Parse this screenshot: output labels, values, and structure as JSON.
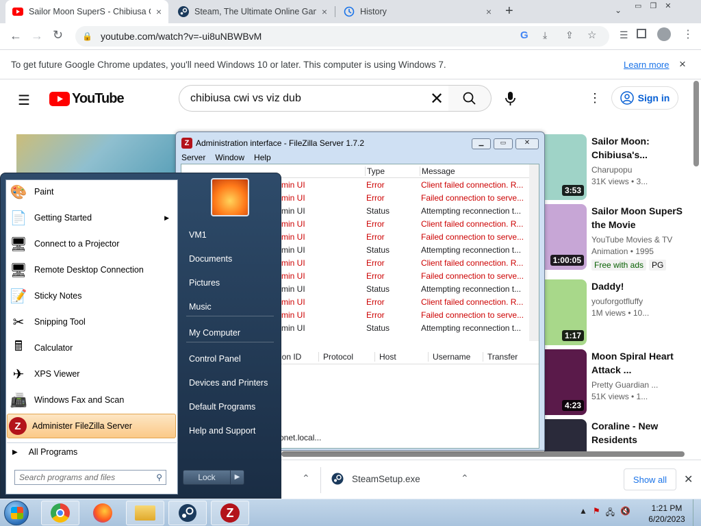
{
  "browser": {
    "tabs": [
      {
        "title": "Sailor Moon SuperS - Chibiusa G",
        "close": "×"
      },
      {
        "title": "Steam, The Ultimate Online Game",
        "close": "×"
      },
      {
        "title": "History",
        "close": "×"
      }
    ],
    "new_tab": "+",
    "url": "youtube.com/watch?v=-ui8uNBWBvM",
    "infobar_text": "To get future Google Chrome updates, you'll need Windows 10 or later. This computer is using Windows 7.",
    "infobar_link": "Learn more",
    "infobar_close": "×"
  },
  "youtube": {
    "logo_text": "YouTube",
    "search_query": "chibiusa cwi vs viz dub",
    "signin_label": "Sign in",
    "cards": [
      {
        "title": "Sailor Moon: Chibiusa's...",
        "channel": "Charupopu",
        "views": "31K views • 3...",
        "duration": "3:53",
        "color": "#9fd3c7"
      },
      {
        "title": "Sailor Moon SuperS the Movie",
        "channel": "YouTube Movies & TV",
        "views": "Animation • 1995",
        "duration": "1:00:05",
        "badge1": "Free with ads",
        "badge2": "PG",
        "color": "#c7a6d6"
      },
      {
        "title": "Daddy!",
        "channel": "youforgotfluffy",
        "views": "1M views • 10...",
        "duration": "1:17",
        "color": "#a8d88a"
      },
      {
        "title": "Moon Spiral Heart Attack ...",
        "channel": "Pretty Guardian ...",
        "views": "51K views • 1...",
        "duration": "4:23",
        "color": "#5a1a4a"
      },
      {
        "title": "Coraline - New Residents",
        "channel": "",
        "views": "",
        "duration": "",
        "color": "#2a2a3a"
      }
    ]
  },
  "filezilla": {
    "title": "Administration interface - FileZilla Server 1.7.2",
    "menu": [
      "Server",
      "Window",
      "Help"
    ],
    "columns": {
      "type": "Type",
      "message": "Message"
    },
    "rows": [
      {
        "src": "min UI",
        "type": "Error",
        "msg": "Client failed connection. R...",
        "err": true
      },
      {
        "src": "min UI",
        "type": "Error",
        "msg": "Failed connection to serve...",
        "err": true
      },
      {
        "src": "min UI",
        "type": "Status",
        "msg": "Attempting reconnection t...",
        "err": false
      },
      {
        "src": "min UI",
        "type": "Error",
        "msg": "Client failed connection. R...",
        "err": true
      },
      {
        "src": "min UI",
        "type": "Error",
        "msg": "Failed connection to serve...",
        "err": true
      },
      {
        "src": "min UI",
        "type": "Status",
        "msg": "Attempting reconnection t...",
        "err": false
      },
      {
        "src": "min UI",
        "type": "Error",
        "msg": "Client failed connection. R...",
        "err": true
      },
      {
        "src": "min UI",
        "type": "Error",
        "msg": "Failed connection to serve...",
        "err": true
      },
      {
        "src": "min UI",
        "type": "Status",
        "msg": "Attempting reconnection t...",
        "err": false
      },
      {
        "src": "min UI",
        "type": "Error",
        "msg": "Client failed connection. R...",
        "err": true
      },
      {
        "src": "min UI",
        "type": "Error",
        "msg": "Failed connection to serve...",
        "err": true
      },
      {
        "src": "min UI",
        "type": "Status",
        "msg": "Attempting reconnection t...",
        "err": false
      }
    ],
    "session_columns": [
      "sion ID",
      "Protocol",
      "Host",
      "Username",
      "Transfer"
    ],
    "statusbar": "onet.local..."
  },
  "startmenu": {
    "left_items": [
      {
        "label": "Paint",
        "icon": "palette-icon",
        "glyph": "🎨"
      },
      {
        "label": "Getting Started",
        "icon": "getting-started-icon",
        "glyph": "📄",
        "arrow": "▶"
      },
      {
        "label": "Connect to a Projector",
        "icon": "projector-icon",
        "glyph": "🖥"
      },
      {
        "label": "Remote Desktop Connection",
        "icon": "remote-desktop-icon",
        "glyph": "🖥"
      },
      {
        "label": "Sticky Notes",
        "icon": "sticky-notes-icon",
        "glyph": "📝"
      },
      {
        "label": "Snipping Tool",
        "icon": "scissors-icon",
        "glyph": "✂"
      },
      {
        "label": "Calculator",
        "icon": "calculator-icon",
        "glyph": "🖩"
      },
      {
        "label": "XPS Viewer",
        "icon": "xps-icon",
        "glyph": "✈"
      },
      {
        "label": "Windows Fax and Scan",
        "icon": "fax-icon",
        "glyph": "📠"
      },
      {
        "label": "Administer FileZilla Server",
        "icon": "filezilla-icon",
        "glyph": "Z"
      }
    ],
    "all_programs": "All Programs",
    "search_placeholder": "Search programs and files",
    "right_items": [
      "VM1",
      "Documents",
      "Pictures",
      "Music",
      "My Computer",
      "Control Panel",
      "Devices and Printers",
      "Default Programs",
      "Help and Support"
    ],
    "lock_label": "Lock"
  },
  "downloads": {
    "file": "SteamSetup.exe",
    "show_all": "Show all"
  },
  "taskbar": {
    "time": "1:21 PM",
    "date": "6/20/2023"
  }
}
